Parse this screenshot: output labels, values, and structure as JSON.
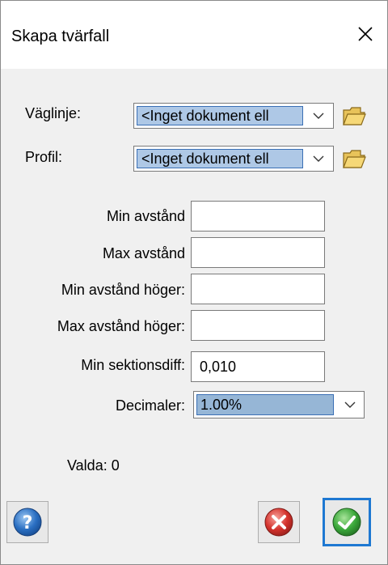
{
  "window": {
    "title": "Skapa tvärfall",
    "close_label": "✕"
  },
  "alignment": {
    "label": "Väglinje:",
    "value": "<Inget dokument ell"
  },
  "profile": {
    "label": "Profil:",
    "value": "<Inget dokument ell"
  },
  "fields": {
    "min_distance_label": "Min avstånd",
    "min_distance_value": "",
    "max_distance_label": "Max avstånd",
    "max_distance_value": "",
    "min_distance_right_label": "Min avstånd höger:",
    "min_distance_right_value": "",
    "max_distance_right_label": "Max avstånd höger:",
    "max_distance_right_value": "",
    "min_section_diff_label": "Min sektionsdiff:",
    "min_section_diff_value": "0,010"
  },
  "decimals": {
    "label": "Decimaler:",
    "value": "1.00%"
  },
  "status": {
    "selected_text": "Valda: 0"
  },
  "icons": {
    "close": "close-icon",
    "dropdown": "chevron-down-icon",
    "browse": "folder-icon",
    "help": "help-icon",
    "cancel": "cancel-icon",
    "ok": "ok-check-icon"
  },
  "colors": {
    "selection_fill": "#aec8e6",
    "selection_border": "#3a6fb5",
    "focus_border": "#1e78d2",
    "help_blue": "#2a6fc2",
    "cancel_red": "#d4322c",
    "ok_green": "#3aa83a"
  }
}
